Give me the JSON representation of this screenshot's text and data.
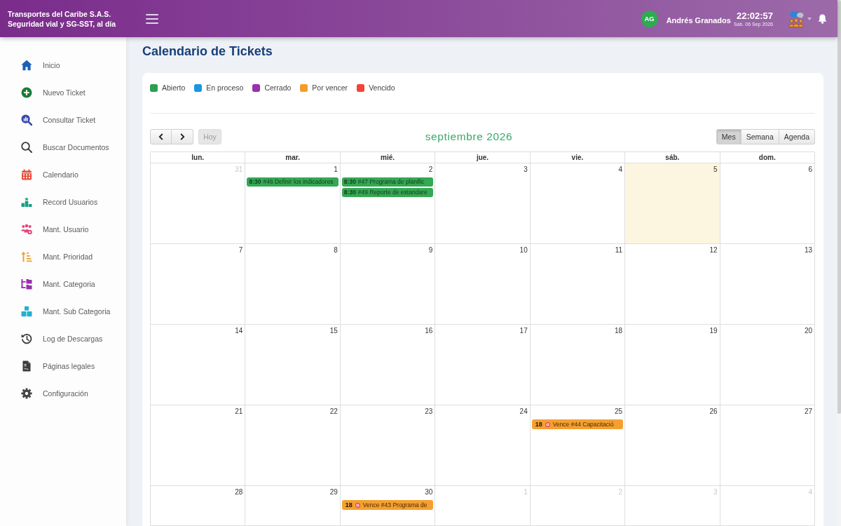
{
  "header": {
    "brand": {
      "name": "Transportes del Caribe S.A.S.",
      "tagline": "Seguridad vial y SG-SST, al día"
    },
    "user": {
      "initials": "AG",
      "name": "Andrés Granados"
    },
    "clock": {
      "time": "22:02:57",
      "date": "Sab. 06 Sep 2026"
    }
  },
  "sidebar": {
    "items": [
      {
        "label": "Inicio"
      },
      {
        "label": "Nuevo Ticket"
      },
      {
        "label": "Consultar Ticket"
      },
      {
        "label": "Buscar Documentos"
      },
      {
        "label": "Calendario"
      },
      {
        "label": "Record Usuarios"
      },
      {
        "label": "Mant. Usuario"
      },
      {
        "label": "Mant. Prioridad"
      },
      {
        "label": "Mant. Categoria"
      },
      {
        "label": "Mant. Sub Categoria"
      },
      {
        "label": "Log de Descargas"
      },
      {
        "label": "Páginas legales"
      },
      {
        "label": "Configuración"
      }
    ]
  },
  "page": {
    "title": "Calendario de Tickets"
  },
  "legend": [
    {
      "label": "Abierto",
      "color": "#2e9e4f"
    },
    {
      "label": "En proceso",
      "color": "#1a96e2"
    },
    {
      "label": "Cerrado",
      "color": "#9b2fae"
    },
    {
      "label": "Por vencer",
      "color": "#f39c2b"
    },
    {
      "label": "Vencido",
      "color": "#f44336"
    }
  ],
  "toolbar": {
    "today_button": {
      "label": "Hoy",
      "disabled": true
    },
    "month_title": "septiembre 2026",
    "views": [
      {
        "label": "Mes",
        "selected": true
      },
      {
        "label": "Semana",
        "selected": false
      },
      {
        "label": "Agenda",
        "selected": false
      }
    ]
  },
  "calendar": {
    "weekdays": [
      "lun.",
      "mar.",
      "mié.",
      "jue.",
      "vie.",
      "sáb.",
      "dom."
    ],
    "weeks": [
      {
        "days": [
          {
            "day": "31",
            "other_month": true,
            "today": false
          },
          {
            "day": "1",
            "other_month": false,
            "today": false,
            "events": [
              {
                "kind": "scheduled",
                "time": "8:30",
                "text": "#46 Definir los indicadores",
                "color": "#34a853"
              }
            ]
          },
          {
            "day": "2",
            "other_month": false,
            "today": false,
            "events": [
              {
                "kind": "scheduled",
                "time": "8:30",
                "text": "#47 Programa de planific",
                "color": "#34a853"
              },
              {
                "kind": "scheduled",
                "time": "8:30",
                "text": "#49 Reporte de estandare",
                "color": "#34a853"
              }
            ]
          },
          {
            "day": "3",
            "other_month": false,
            "today": false
          },
          {
            "day": "4",
            "other_month": false,
            "today": false
          },
          {
            "day": "5",
            "other_month": false,
            "today": true
          },
          {
            "day": "6",
            "other_month": false,
            "today": false
          }
        ]
      },
      {
        "days": [
          {
            "day": "7",
            "other_month": false,
            "today": false
          },
          {
            "day": "8",
            "other_month": false,
            "today": false
          },
          {
            "day": "9",
            "other_month": false,
            "today": false
          },
          {
            "day": "10",
            "other_month": false,
            "today": false
          },
          {
            "day": "11",
            "other_month": false,
            "today": false
          },
          {
            "day": "12",
            "other_month": false,
            "today": false
          },
          {
            "day": "13",
            "other_month": false,
            "today": false
          }
        ]
      },
      {
        "days": [
          {
            "day": "14",
            "other_month": false,
            "today": false
          },
          {
            "day": "15",
            "other_month": false,
            "today": false
          },
          {
            "day": "16",
            "other_month": false,
            "today": false
          },
          {
            "day": "17",
            "other_month": false,
            "today": false
          },
          {
            "day": "18",
            "other_month": false,
            "today": false
          },
          {
            "day": "19",
            "other_month": false,
            "today": false
          },
          {
            "day": "20",
            "other_month": false,
            "today": false
          }
        ]
      },
      {
        "days": [
          {
            "day": "21",
            "other_month": false,
            "today": false
          },
          {
            "day": "22",
            "other_month": false,
            "today": false
          },
          {
            "day": "23",
            "other_month": false,
            "today": false
          },
          {
            "day": "24",
            "other_month": false,
            "today": false
          },
          {
            "day": "25",
            "other_month": false,
            "today": false,
            "events": [
              {
                "kind": "due",
                "time": "18",
                "text": "Vence #44 Capacitació",
                "color": "#f4a031"
              }
            ]
          },
          {
            "day": "26",
            "other_month": false,
            "today": false
          },
          {
            "day": "27",
            "other_month": false,
            "today": false
          }
        ]
      },
      {
        "days": [
          {
            "day": "28",
            "other_month": false,
            "today": false
          },
          {
            "day": "29",
            "other_month": false,
            "today": false
          },
          {
            "day": "30",
            "other_month": false,
            "today": false,
            "events": [
              {
                "kind": "due",
                "time": "18",
                "text": "Vence #43 Programa de",
                "color": "#f4a031"
              }
            ]
          },
          {
            "day": "1",
            "other_month": true,
            "today": false
          },
          {
            "day": "2",
            "other_month": true,
            "today": false
          },
          {
            "day": "3",
            "other_month": true,
            "today": false
          },
          {
            "day": "4",
            "other_month": true,
            "today": false
          }
        ]
      }
    ]
  }
}
